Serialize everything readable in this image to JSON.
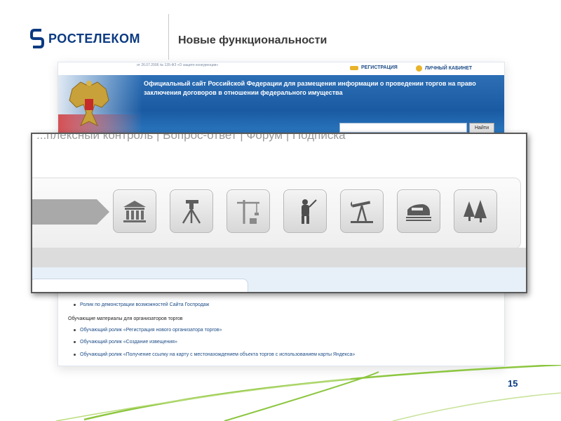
{
  "slide": {
    "logo_text": "РОСТЕЛЕКОМ",
    "title": "Новые функциональности",
    "page_number": "15"
  },
  "site": {
    "tiny_text": "от 26.07.2006 № 135-ФЗ «О защите конкуренции»",
    "links": {
      "registration": "РЕГИСТРАЦИЯ",
      "cabinet": "ЛИЧНЫЙ КАБИНЕТ"
    },
    "banner_text": "Официальный сайт Российской Федерации для размещения информации о проведении торгов на право заключения договоров в отношении федерального имущества",
    "search_button": "Найти",
    "bullets_top": [
      "Ролик по демонстрации возможностей Сайта Госпродаж"
    ],
    "section_heading": "Обучающие материалы для организаторов торгов",
    "bullets": [
      "Обучающий ролик «Регистрация нового организатора торгов»",
      "Обучающий ролик «Создание извещения»",
      "Обучающий ролик «Получение ссылку на карту с местонахождением объекта торгов с использованием карты Яндекса»"
    ]
  },
  "zoom": {
    "nav_text": "...плексный контроль  |  Вопрос-ответ  |  Форум  |  Подписка",
    "categories": [
      {
        "icon": "government-building-icon"
      },
      {
        "icon": "theodolite-icon"
      },
      {
        "icon": "construction-crane-icon"
      },
      {
        "icon": "hunter-icon"
      },
      {
        "icon": "oil-pump-icon"
      },
      {
        "icon": "high-speed-train-icon"
      },
      {
        "icon": "forest-icon"
      }
    ]
  },
  "colors": {
    "brand_blue": "#0b3a82",
    "banner_blue": "#1a5aa2",
    "accent_green": "#8cc63f"
  }
}
